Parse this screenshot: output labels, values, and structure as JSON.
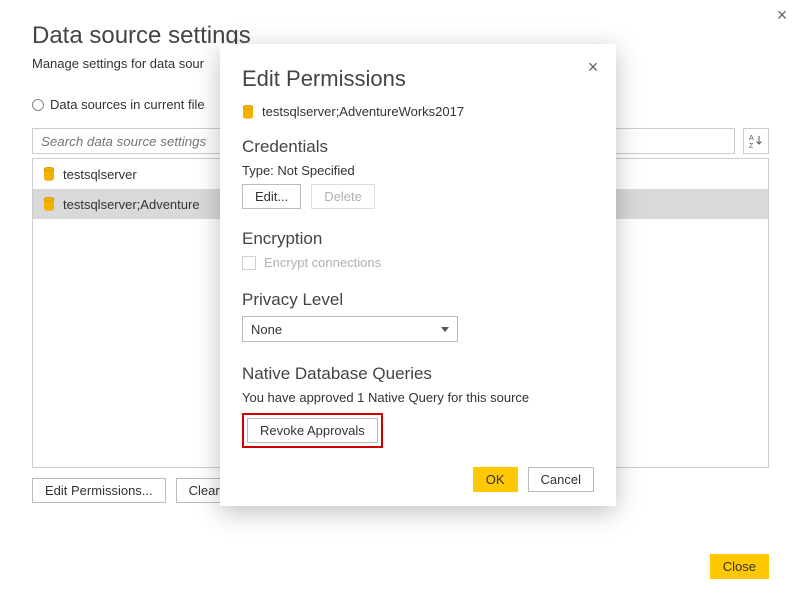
{
  "outer": {
    "title": "Data source settings",
    "subtitle": "Manage settings for data sour",
    "radio_label": "Data sources in current file",
    "search_placeholder": "Search data source settings",
    "sort_label": "A↓Z",
    "items": [
      {
        "label": "testsqlserver"
      },
      {
        "label": "testsqlserver;Adventure"
      }
    ],
    "edit_perm_btn": "Edit Permissions...",
    "clear_perm_btn": "Clear Perm",
    "close_btn": "Close"
  },
  "modal": {
    "title": "Edit Permissions",
    "ds_name": "testsqlserver;AdventureWorks2017",
    "credentials": {
      "head": "Credentials",
      "type_line": "Type: Not Specified",
      "edit_btn": "Edit...",
      "delete_btn": "Delete"
    },
    "encryption": {
      "head": "Encryption",
      "checkbox_label": "Encrypt connections"
    },
    "privacy": {
      "head": "Privacy Level",
      "value": "None"
    },
    "native": {
      "head": "Native Database Queries",
      "text": "You have approved 1 Native Query for this source",
      "revoke_btn": "Revoke Approvals"
    },
    "ok_btn": "OK",
    "cancel_btn": "Cancel"
  }
}
